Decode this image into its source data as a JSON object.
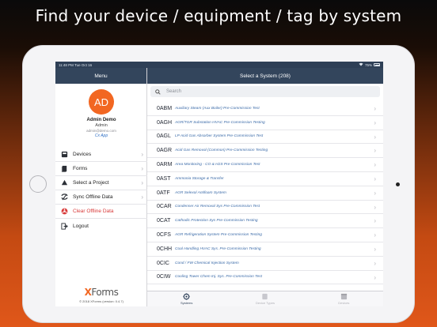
{
  "headline": "Find your device / equipment / tag by system",
  "status_bar": {
    "time": "11:48 PM   Tue Oct 16",
    "battery": "75%"
  },
  "sidebar": {
    "title": "Menu",
    "profile": {
      "initials": "AD",
      "name": "Admin Demo",
      "role": "Admin",
      "email": "admin@demo.com",
      "app": "Cx App"
    },
    "items": [
      {
        "label": "Devices",
        "icon": "devices-icon"
      },
      {
        "label": "Forms",
        "icon": "forms-icon"
      },
      {
        "label": "Select a Project",
        "icon": "project-icon"
      },
      {
        "label": "Sync Offline Data",
        "icon": "sync-icon"
      },
      {
        "label": "Clear Offline Data",
        "icon": "clear-data-icon"
      },
      {
        "label": "Logout",
        "icon": "logout-icon"
      }
    ],
    "logo_x": "X",
    "logo_rest": "Forms",
    "copyright": "© 2018 XForms (version: 0.4.7)"
  },
  "main": {
    "title": "Select a System (208)",
    "search_placeholder": "Search",
    "systems": [
      {
        "code": "0ABM",
        "desc": "Auxiliary Steam (Aux Boiler) Pre-Commission Test"
      },
      {
        "code": "0AGH",
        "desc": "AGR/TGR Substation HVAC Pre-Commission Testing"
      },
      {
        "code": "0AGL",
        "desc": "LP Acid Gas Absorber System Pre-Commission Test"
      },
      {
        "code": "0AGR",
        "desc": "Acid Gas Removal (Common) Pre-Commission Testing"
      },
      {
        "code": "0ARM",
        "desc": "Area Monitoring - CO & H2S Pre-Commission Test"
      },
      {
        "code": "0AST",
        "desc": "Ammonia Storage & Transfer"
      },
      {
        "code": "0ATF",
        "desc": "AGR Selexol Antifoam System"
      },
      {
        "code": "0CAR",
        "desc": "Condenser Air Removal Sys Pre-Commission Test"
      },
      {
        "code": "0CAT",
        "desc": "Cathodic Protection Sys Pre-Commission Testing"
      },
      {
        "code": "0CFS",
        "desc": "AGR Refrigeration System Pre-Commission Testing"
      },
      {
        "code": "0CHH",
        "desc": "Coal Handling HVAC Sys. Pre-Commission Testing"
      },
      {
        "code": "0CIC",
        "desc": "Cond / FW Chemical Injection System"
      },
      {
        "code": "0CIW",
        "desc": "Cooling Tower Chem Inj. Sys. Pre-Commission Test"
      }
    ],
    "tabs": [
      {
        "label": "Systems",
        "icon": "systems-icon",
        "active": true
      },
      {
        "label": "Device Types",
        "icon": "device-types-icon",
        "active": false
      },
      {
        "label": "Devices",
        "icon": "devices-tab-icon",
        "active": false
      }
    ]
  },
  "colors": {
    "header": "#33455c",
    "accent": "#f26722",
    "link": "#3a6aa8",
    "danger": "#d83a3a"
  }
}
